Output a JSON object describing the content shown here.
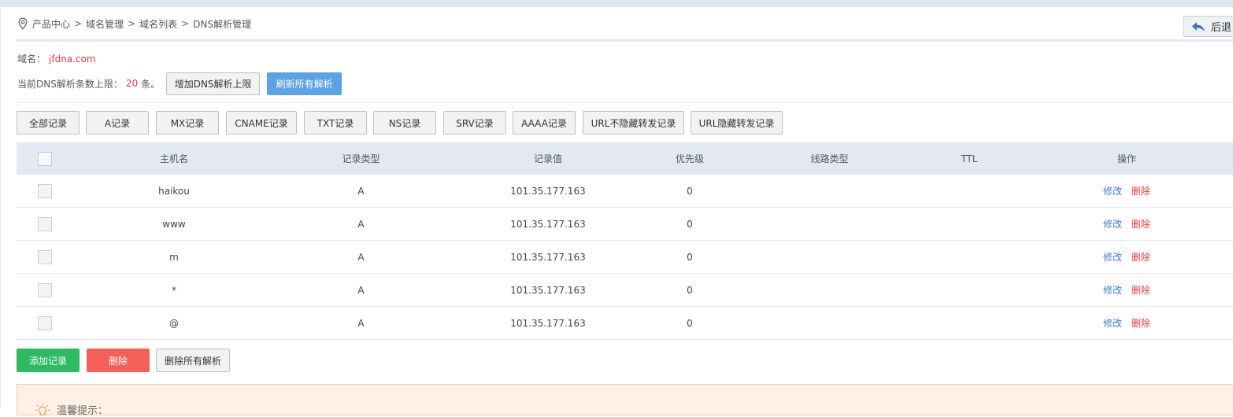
{
  "breadcrumb": {
    "items": [
      "产品中心",
      "域名管理",
      "域名列表",
      "DNS解析管理"
    ],
    "separator": ">"
  },
  "back_button": {
    "label": "后退"
  },
  "domain": {
    "label": "域名：",
    "value": "jfdna.com"
  },
  "limit": {
    "prefix": "当前DNS解析条数上限：",
    "count": "20",
    "suffix": "条。",
    "increase_button": "增加DNS解析上限",
    "refresh_button": "刷新所有解析"
  },
  "filters": [
    "全部记录",
    "A记录",
    "MX记录",
    "CNAME记录",
    "TXT记录",
    "NS记录",
    "SRV记录",
    "AAAA记录",
    "URL不隐藏转发记录",
    "URL隐藏转发记录"
  ],
  "table": {
    "columns": [
      "主机名",
      "记录类型",
      "记录值",
      "优先级",
      "线路类型",
      "TTL",
      "操作"
    ],
    "rows": [
      {
        "host": "haikou",
        "type": "A",
        "value": "101.35.177.163",
        "priority": "0",
        "line": "",
        "ttl": ""
      },
      {
        "host": "www",
        "type": "A",
        "value": "101.35.177.163",
        "priority": "0",
        "line": "",
        "ttl": ""
      },
      {
        "host": "m",
        "type": "A",
        "value": "101.35.177.163",
        "priority": "0",
        "line": "",
        "ttl": ""
      },
      {
        "host": "*",
        "type": "A",
        "value": "101.35.177.163",
        "priority": "0",
        "line": "",
        "ttl": ""
      },
      {
        "host": "@",
        "type": "A",
        "value": "101.35.177.163",
        "priority": "0",
        "line": "",
        "ttl": ""
      }
    ],
    "edit_label": "修改",
    "delete_label": "删除"
  },
  "actions": {
    "add": "添加记录",
    "delete": "删除",
    "delete_all": "删除所有解析"
  },
  "tip": {
    "title": "温馨提示："
  },
  "icons": {
    "breadcrumb": "location-pin-icon",
    "back": "back-arrow-icon",
    "tip": "lightbulb-icon"
  },
  "colors": {
    "accent_blue": "#5ca3e6",
    "green": "#2dba61",
    "red": "#f45f58",
    "highlight_red": "#e4393c",
    "table_header": "#e3e9f3"
  }
}
